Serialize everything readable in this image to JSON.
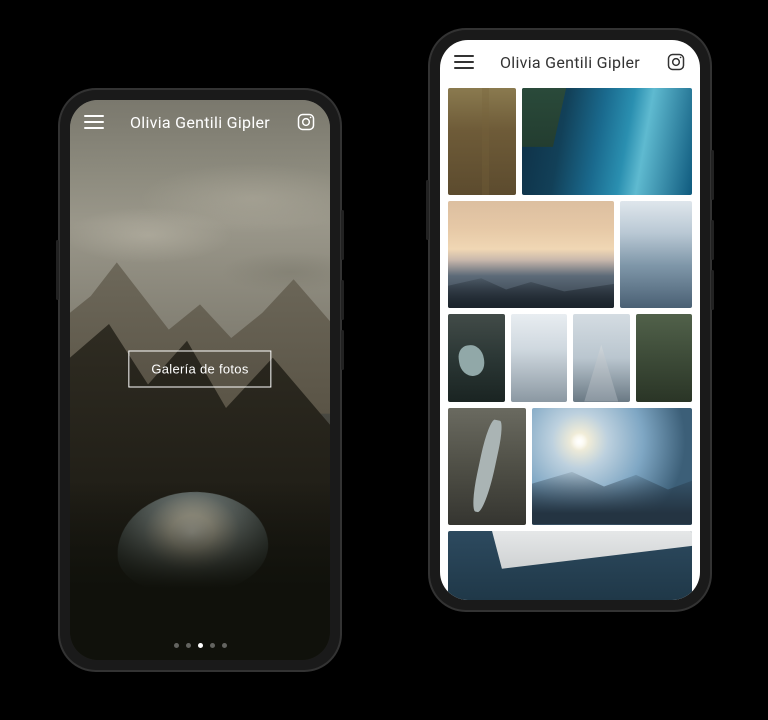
{
  "left": {
    "header": {
      "title": "Olivia Gentili Gipler",
      "menu_icon": "hamburger-icon",
      "social_icon": "instagram-icon"
    },
    "cta_label": "Galería de fotos",
    "carousel": {
      "total": 5,
      "active_index": 2
    }
  },
  "right": {
    "header": {
      "title": "Olivia Gentili Gipler",
      "menu_icon": "hamburger-icon",
      "social_icon": "instagram-icon"
    },
    "gallery": {
      "rows": [
        [
          "aerial-field",
          "coastline"
        ],
        [
          "sunset-mountain",
          "snow-forest"
        ],
        [
          "lake-overhead",
          "snow-ridge",
          "snow-peak",
          "forest-valley"
        ],
        [
          "river-canyon",
          "sunburst-valley"
        ],
        [
          "airplane-wing"
        ]
      ]
    }
  }
}
